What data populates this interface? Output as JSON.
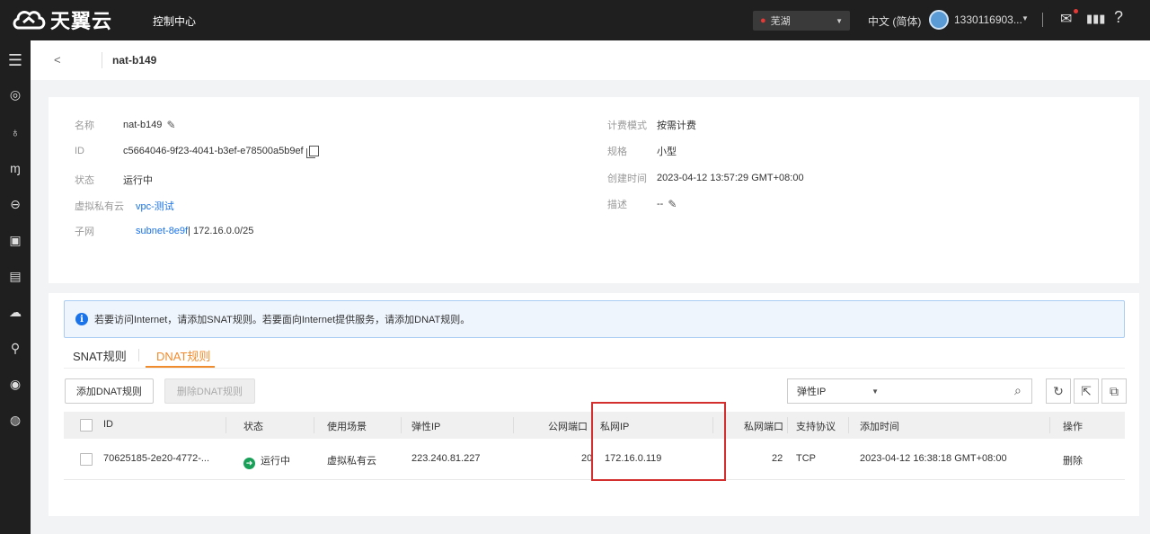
{
  "topbar": {
    "logo_text": "天翼云",
    "console": "控制中心",
    "region": "芜湖",
    "language": "中文 (简体)",
    "user": "1330116903..."
  },
  "breadcrumb": {
    "title": "nat-b149"
  },
  "info": {
    "name_label": "名称",
    "name_value": "nat-b149",
    "id_label": "ID",
    "id_value": "c5664046-9f23-4041-b3ef-e78500a5b9ef",
    "status_label": "状态",
    "status_value": "运行中",
    "vpc_label": "虚拟私有云",
    "vpc_value": "vpc-测试",
    "subnet_label": "子网",
    "subnet_link": "subnet-8e9f",
    "subnet_cidr": " | 172.16.0.0/25",
    "billing_label": "计费模式",
    "billing_value": "按需计费",
    "spec_label": "规格",
    "spec_value": "小型",
    "created_label": "创建时间",
    "created_value": "2023-04-12 13:57:29 GMT+08:00",
    "desc_label": "描述",
    "desc_value": "--"
  },
  "notice": "若要访问Internet，请添加SNAT规则。若要面向Internet提供服务，请添加DNAT规则。",
  "tabs": {
    "snat": "SNAT规则",
    "dnat": "DNAT规则"
  },
  "toolbar": {
    "add_label": "添加DNAT规则",
    "delete_label": "删除DNAT规则",
    "filter_selected": "弹性IP",
    "search_value": ""
  },
  "table": {
    "headers": {
      "id": "ID",
      "status": "状态",
      "scenario": "使用场景",
      "eip": "弹性IP",
      "public_port": "公网端口",
      "private_ip": "私网IP",
      "private_port": "私网端口",
      "protocol": "支持协议",
      "created": "添加时间",
      "action": "操作"
    },
    "rows": [
      {
        "id": "70625185-2e20-4772-...",
        "status": "运行中",
        "scenario": "虚拟私有云",
        "eip": "223.240.81.227",
        "public_port": "20",
        "private_ip": "172.16.0.119",
        "private_port": "22",
        "protocol": "TCP",
        "created": "2023-04-12 16:38:18 GMT+08:00",
        "action": "删除"
      }
    ]
  },
  "colors": {
    "accent_orange": "#f08c2e",
    "link_blue": "#1a73e8",
    "highlight_red": "#d32f2f",
    "status_green": "#18a058"
  }
}
